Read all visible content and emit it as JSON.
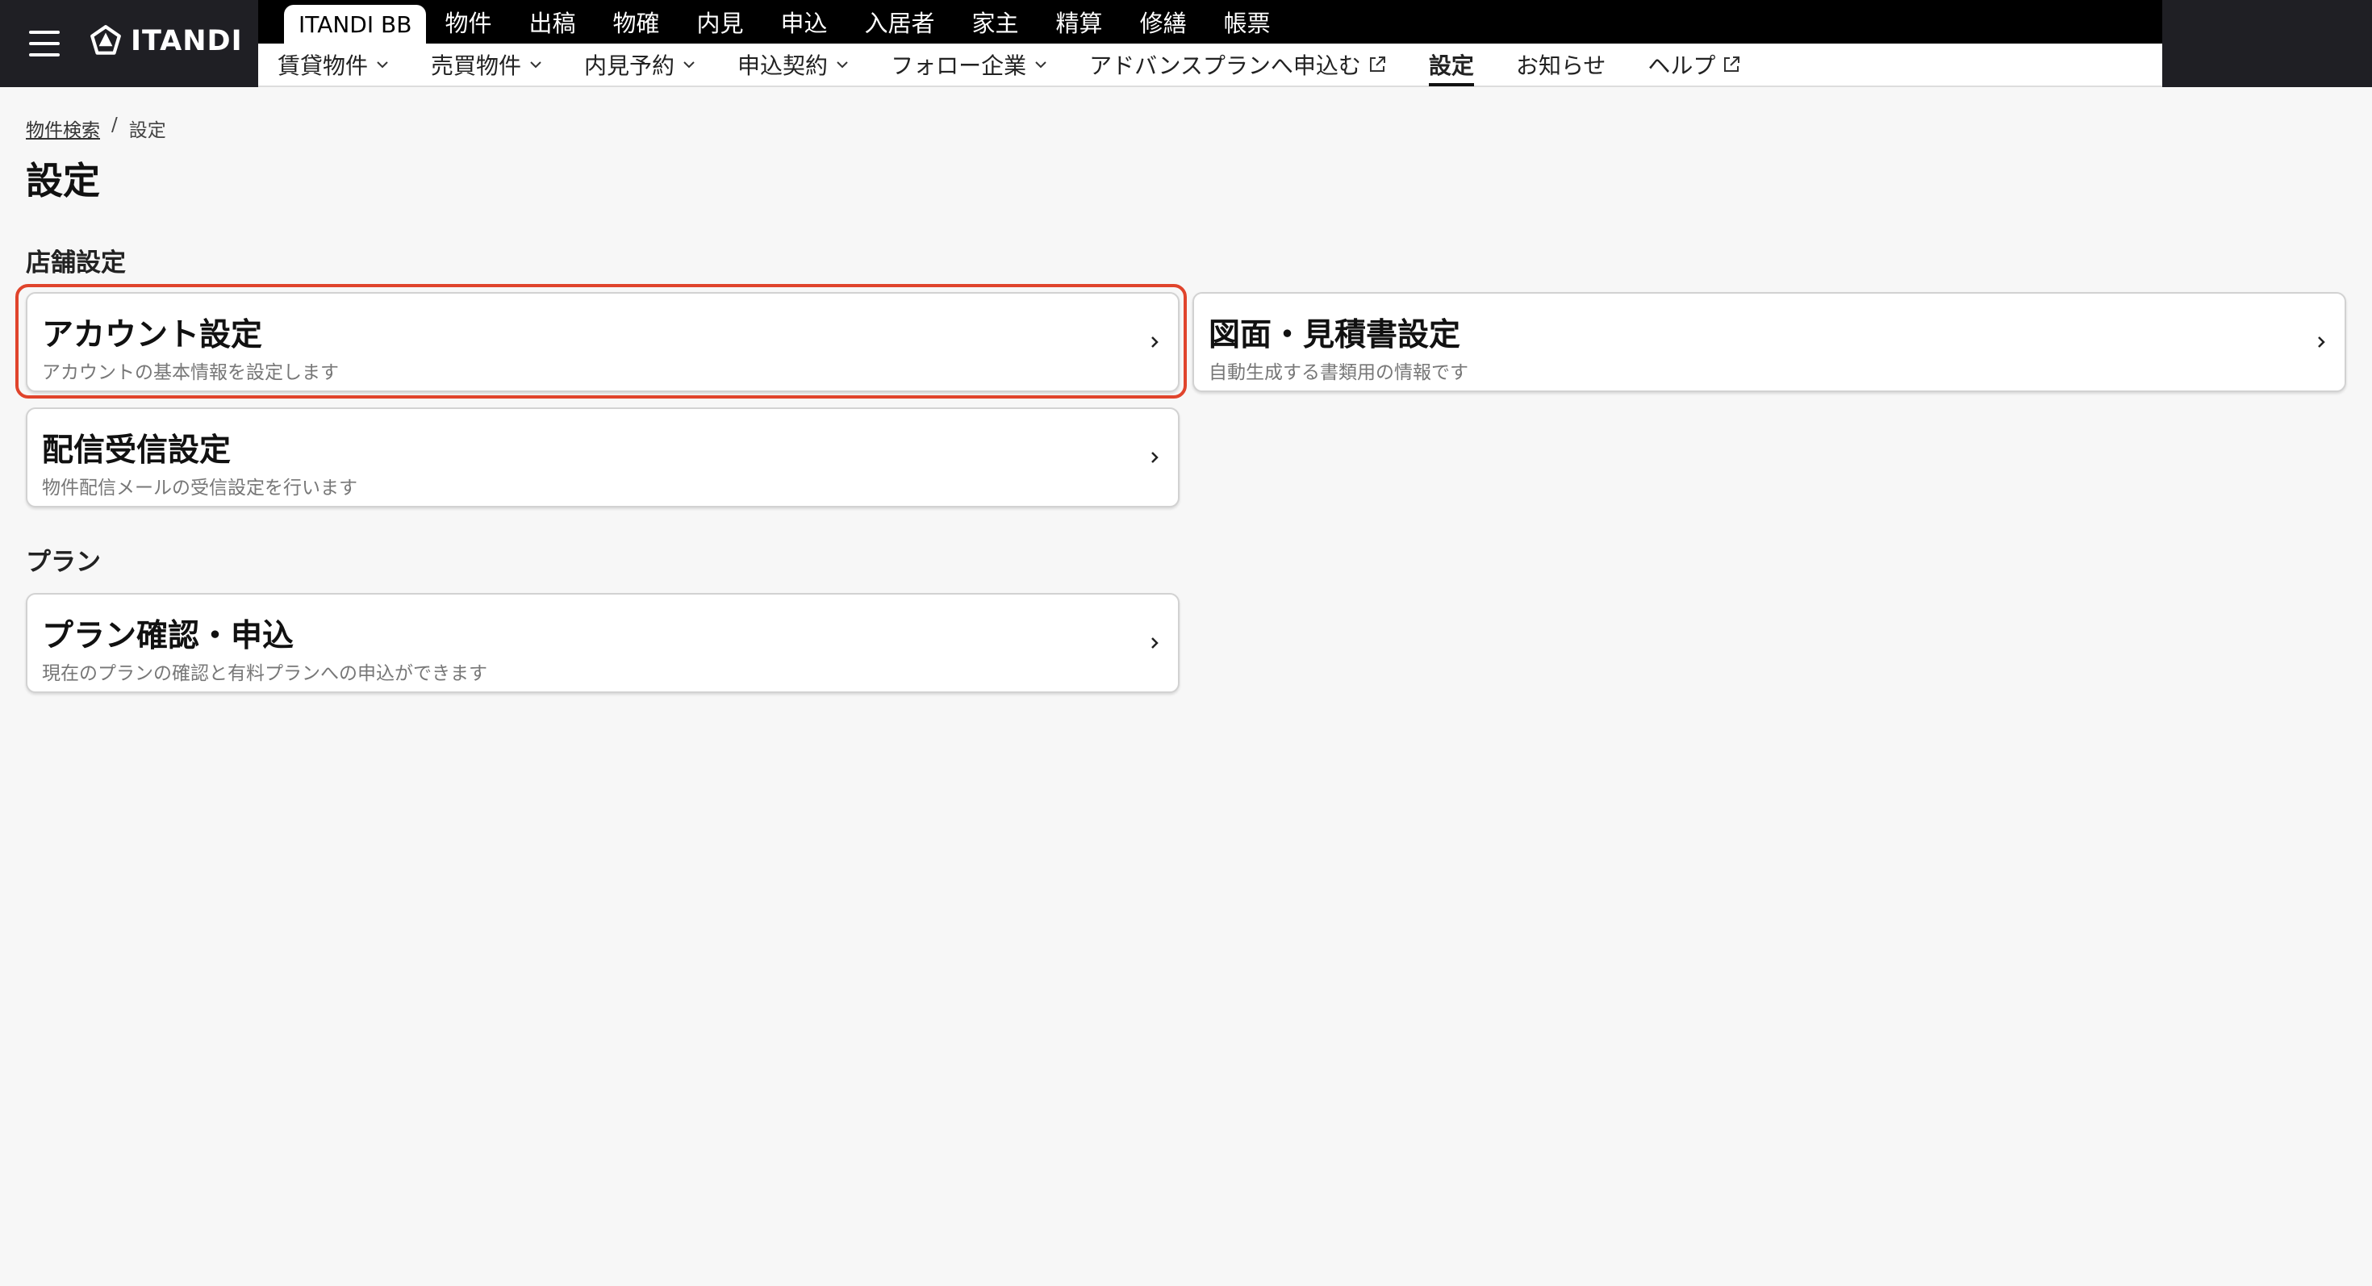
{
  "brand": {
    "logo_text": "ITANDI",
    "menu_icon": "hamburger-menu-icon"
  },
  "topnav": {
    "app_tab": "ITANDI BB",
    "tabs": [
      "物件",
      "出稿",
      "物確",
      "内見",
      "申込",
      "入居者",
      "家主",
      "精算",
      "修繕",
      "帳票"
    ]
  },
  "subnav": {
    "items": [
      {
        "label": "賃貸物件",
        "icon": "chevron-down-icon"
      },
      {
        "label": "売買物件",
        "icon": "chevron-down-icon"
      },
      {
        "label": "内見予約",
        "icon": "chevron-down-icon"
      },
      {
        "label": "申込契約",
        "icon": "chevron-down-icon"
      },
      {
        "label": "フォロー企業",
        "icon": "chevron-down-icon"
      },
      {
        "label": "アドバンスプランへ申込む",
        "icon": "external-link-icon"
      },
      {
        "label": "設定",
        "active": true
      },
      {
        "label": "お知らせ"
      },
      {
        "label": "ヘルプ",
        "icon": "external-link-icon"
      }
    ]
  },
  "breadcrumb": {
    "parent": "物件検索",
    "separator": "/",
    "current": "設定"
  },
  "page": {
    "title": "設定"
  },
  "sections": {
    "store": {
      "heading": "店舗設定",
      "cards": [
        {
          "title": "アカウント設定",
          "description": "アカウントの基本情報を設定します"
        },
        {
          "title": "図面・見積書設定",
          "description": "自動生成する書類用の情報です"
        },
        {
          "title": "配信受信設定",
          "description": "物件配信メールの受信設定を行います"
        }
      ]
    },
    "plan": {
      "heading": "プラン",
      "cards": [
        {
          "title": "プラン確認・申込",
          "description": "現在のプランの確認と有料プランへの申込ができます"
        }
      ]
    }
  },
  "colors": {
    "nav_bg": "#000000",
    "brand_bg": "#1f1f24",
    "highlight": "#e0442c",
    "page_bg": "#f7f7f7"
  }
}
